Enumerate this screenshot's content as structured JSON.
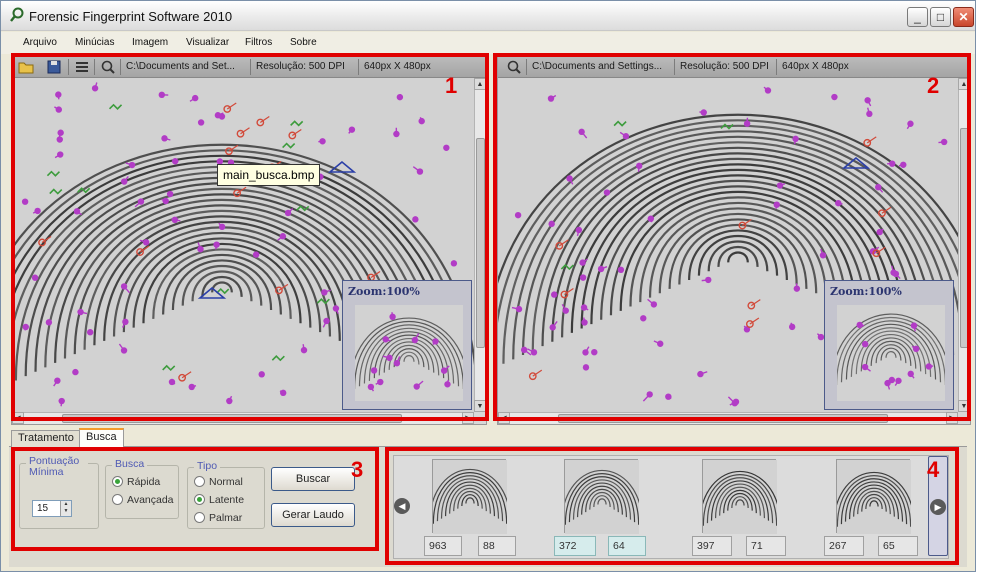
{
  "window": {
    "title": "Forensic Fingerprint Software 2010",
    "minimize": "_",
    "maximize": "□",
    "close": "✕"
  },
  "menu": [
    "Arquivo",
    "Minúcias",
    "Imagem",
    "Visualizar",
    "Filtros",
    "Sobre"
  ],
  "left_pane": {
    "path": "C:\\Documents and Set...",
    "resolution": "Resolução: 500 DPI",
    "size": "640px X 480px",
    "zoom_label": "Zoom:100%",
    "tooltip": "main_busca.bmp",
    "icons": [
      "open-folder-icon",
      "save-disk-icon",
      "list-icon",
      "magnifier-icon"
    ]
  },
  "right_pane": {
    "path": "C:\\Documents and Settings...",
    "resolution": "Resolução: 500 DPI",
    "size": "640px X 480px",
    "zoom_label": "Zoom:100%",
    "icons": [
      "magnifier-icon"
    ]
  },
  "tabs": [
    {
      "label": "Tratamento",
      "active": false
    },
    {
      "label": "Busca",
      "active": true
    }
  ],
  "busca": {
    "pontuacao": {
      "title": "Pontuação Mínima",
      "value": "15"
    },
    "busca_group": {
      "title": "Busca",
      "options": [
        {
          "label": "Rápida",
          "selected": true
        },
        {
          "label": "Avançada",
          "selected": false
        }
      ]
    },
    "tipo_group": {
      "title": "Tipo",
      "options": [
        {
          "label": "Normal",
          "selected": false
        },
        {
          "label": "Latente",
          "selected": true
        },
        {
          "label": "Palmar",
          "selected": false
        }
      ]
    },
    "buscar_label": "Buscar",
    "gerar_laudo_label": "Gerar Laudo"
  },
  "results": [
    {
      "score_a": "963",
      "score_b": "88",
      "highlight": false
    },
    {
      "score_a": "372",
      "score_b": "64",
      "highlight": true
    },
    {
      "score_a": "397",
      "score_b": "71",
      "highlight": false
    },
    {
      "score_a": "267",
      "score_b": "65",
      "highlight": false
    }
  ],
  "annotations": [
    "1",
    "2",
    "3",
    "4"
  ],
  "colors": {
    "annotation_red": "#e00000",
    "minutia_magenta": "#b23cc6",
    "minutia_red": "#d24a3a",
    "minutia_green": "#3d9c3d",
    "core_marker_blue": "#2b3fa8",
    "tab_accent": "#f29b2c"
  }
}
